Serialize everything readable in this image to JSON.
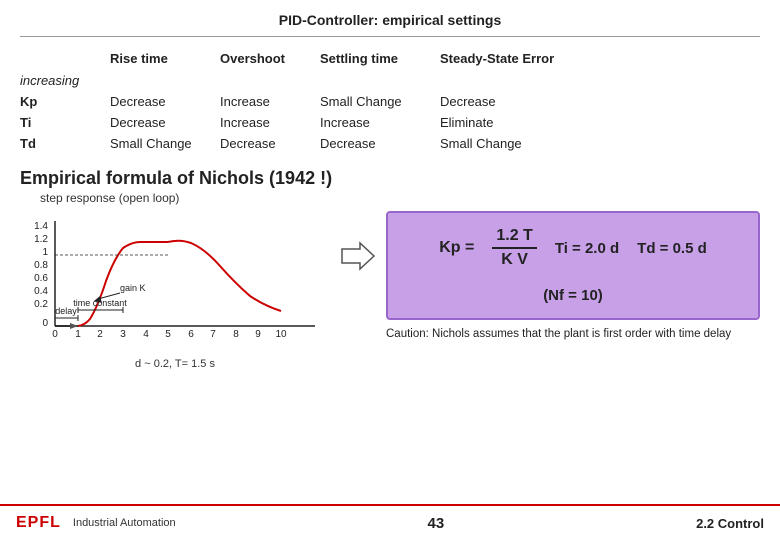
{
  "header": {
    "title": "PID-Controller: empirical settings"
  },
  "table": {
    "columns": [
      "",
      "Rise time",
      "Overshoot",
      "Settling time",
      "Steady-State Error"
    ],
    "increasing_label": "increasing",
    "rows": [
      {
        "label": "Kp",
        "rise_time": "Decrease",
        "overshoot": "Increase",
        "settling_time": "Small Change",
        "steady_state": "Decrease"
      },
      {
        "label": "Ti",
        "rise_time": "Decrease",
        "overshoot": "Increase",
        "settling_time": "Increase",
        "steady_state": "Eliminate"
      },
      {
        "label": "Td",
        "rise_time": "Small Change",
        "overshoot": "Decrease",
        "settling_time": "Decrease",
        "steady_state": "Small Change"
      }
    ]
  },
  "empirical": {
    "title": "Empirical formula of Nichols (1942 !)",
    "step_response": "step response (open loop)",
    "delay_label": "delay",
    "time_constant_label": "time constant",
    "gain_label": "gain K",
    "d_label": "d ~ 0.2, T= 1.5 s",
    "formula": {
      "kp_label": "Kp =",
      "numerator": "1.2 T",
      "denominator": "K V",
      "ti": "Ti = 2.0 d",
      "td": "Td = 0.5 d",
      "nf": "(Nf = 10)"
    },
    "caution": {
      "text": "Caution: Nichols assumes that the plant is first order with time delay"
    }
  },
  "footer": {
    "logo": "EPFL",
    "left_text": "Industrial Automation",
    "page_number": "43",
    "section": "2.2 Control"
  }
}
